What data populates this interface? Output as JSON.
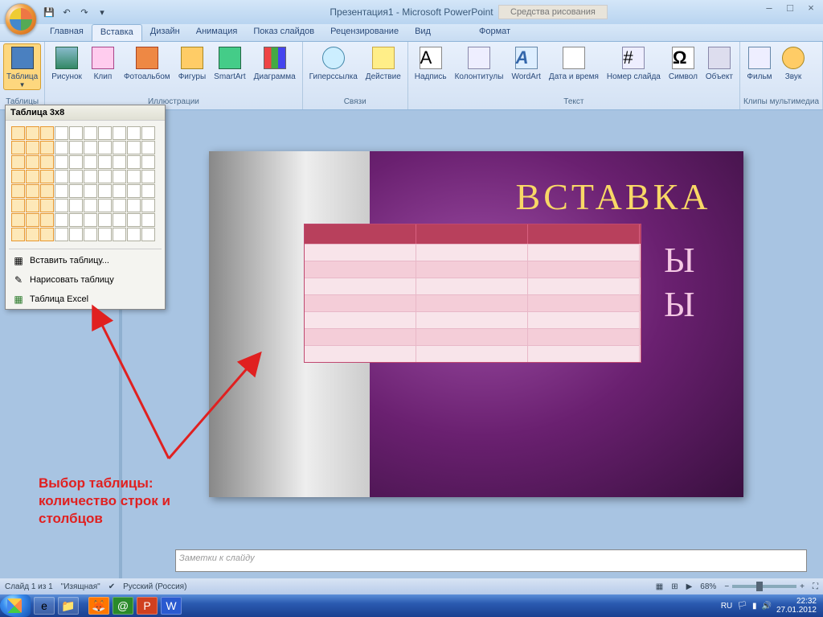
{
  "window": {
    "title": "Презентация1 - Microsoft PowerPoint",
    "contextual_tab_title": "Средства рисования"
  },
  "qat": {
    "save": "💾",
    "undo": "↶",
    "redo": "↷"
  },
  "tabs": {
    "home": "Главная",
    "insert": "Вставка",
    "design": "Дизайн",
    "animation": "Анимация",
    "slideshow": "Показ слайдов",
    "review": "Рецензирование",
    "view": "Вид",
    "format": "Формат"
  },
  "ribbon": {
    "groups": {
      "tables": "Таблицы",
      "illustrations": "Иллюстрации",
      "links": "Связи",
      "text": "Текст",
      "media": "Клипы мультимедиа"
    },
    "buttons": {
      "table": "Таблица",
      "picture": "Рисунок",
      "clip": "Клип",
      "album": "Фотоальбом",
      "shapes": "Фигуры",
      "smartart": "SmartArt",
      "chart": "Диаграмма",
      "hyperlink": "Гиперссылка",
      "action": "Действие",
      "textbox": "Надпись",
      "headerfooter": "Колонтитулы",
      "wordart": "WordArt",
      "datetime": "Дата и время",
      "slidenum": "Номер слайда",
      "symbol": "Символ",
      "object": "Объект",
      "movie": "Фильм",
      "sound": "Звук"
    }
  },
  "table_dropdown": {
    "title": "Таблица 3x8",
    "selected": {
      "cols": 3,
      "rows": 8
    },
    "grid": {
      "cols": 10,
      "rows": 8
    },
    "insert_table": "Вставить таблицу...",
    "draw_table": "Нарисовать таблицу",
    "excel_table": "Таблица Excel"
  },
  "slide": {
    "title_text": "ВСТАВКА",
    "sub1": "Ы",
    "sub2": "Ы"
  },
  "inserted_table": {
    "cols": 3,
    "rows": 8
  },
  "notes_placeholder": "Заметки к слайду",
  "annotation": {
    "text": "Выбор таблицы: количество строк и столбцов"
  },
  "statusbar": {
    "slide_info": "Слайд 1 из 1",
    "theme": "\"Изящная\"",
    "language": "Русский (Россия)",
    "zoom": "68%"
  },
  "tray": {
    "lang": "RU",
    "time": "22:32",
    "date": "27.01.2012"
  }
}
